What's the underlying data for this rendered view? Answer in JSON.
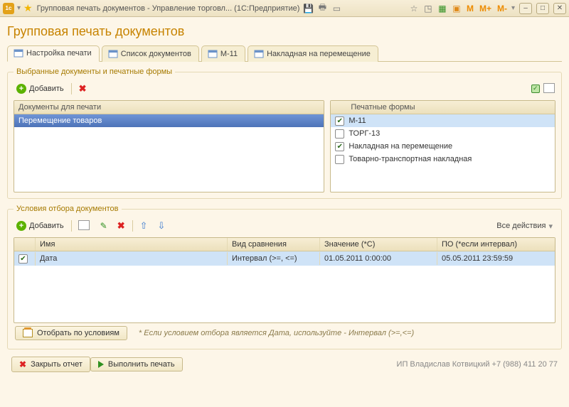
{
  "window": {
    "title": "Групповая печать документов - Управление торговл...   (1С:Предприятие)",
    "mem_buttons": [
      "M",
      "M+",
      "M-"
    ]
  },
  "page": {
    "title": "Групповая печать документов"
  },
  "tabs": [
    {
      "label": "Настройка печати",
      "active": true
    },
    {
      "label": "Список документов",
      "active": false
    },
    {
      "label": "М-11",
      "active": false
    },
    {
      "label": "Накладная на перемещение",
      "active": false
    }
  ],
  "group_printforms": {
    "legend": "Выбранные документы и печатные формы",
    "add_label": "Добавить",
    "docs_header": "Документы для печати",
    "docs": [
      {
        "label": "Перемещение товаров",
        "selected": true
      }
    ],
    "forms_header": "Печатные формы",
    "forms": [
      {
        "label": "М-11",
        "checked": true,
        "highlight": true
      },
      {
        "label": "ТОРГ-13",
        "checked": false,
        "highlight": false
      },
      {
        "label": "Накладная на перемещение",
        "checked": true,
        "highlight": false
      },
      {
        "label": "Товарно-транспортная накладная",
        "checked": false,
        "highlight": false
      }
    ]
  },
  "group_filter": {
    "legend": "Условия отбора документов",
    "add_label": "Добавить",
    "all_actions": "Все действия",
    "columns": {
      "name": "Имя",
      "cmp": "Вид сравнения",
      "val": "Значение (*С)",
      "to": "ПО (*если интервал)"
    },
    "rows": [
      {
        "checked": true,
        "name": "Дата",
        "cmp": "Интервал (>=, <=)",
        "val": "01.05.2011 0:00:00",
        "to": "05.05.2011 23:59:59",
        "selected": true
      }
    ],
    "select_btn": "Отобрать по условиям",
    "hint": "* Если условием отбора является Дата, используйте - Интервал (>=,<=)"
  },
  "footer": {
    "close_label": "Закрыть отчет",
    "run_label": "Выполнить печать",
    "status": "ИП Владислав Котвицкий +7 (988) 411 20 77"
  }
}
